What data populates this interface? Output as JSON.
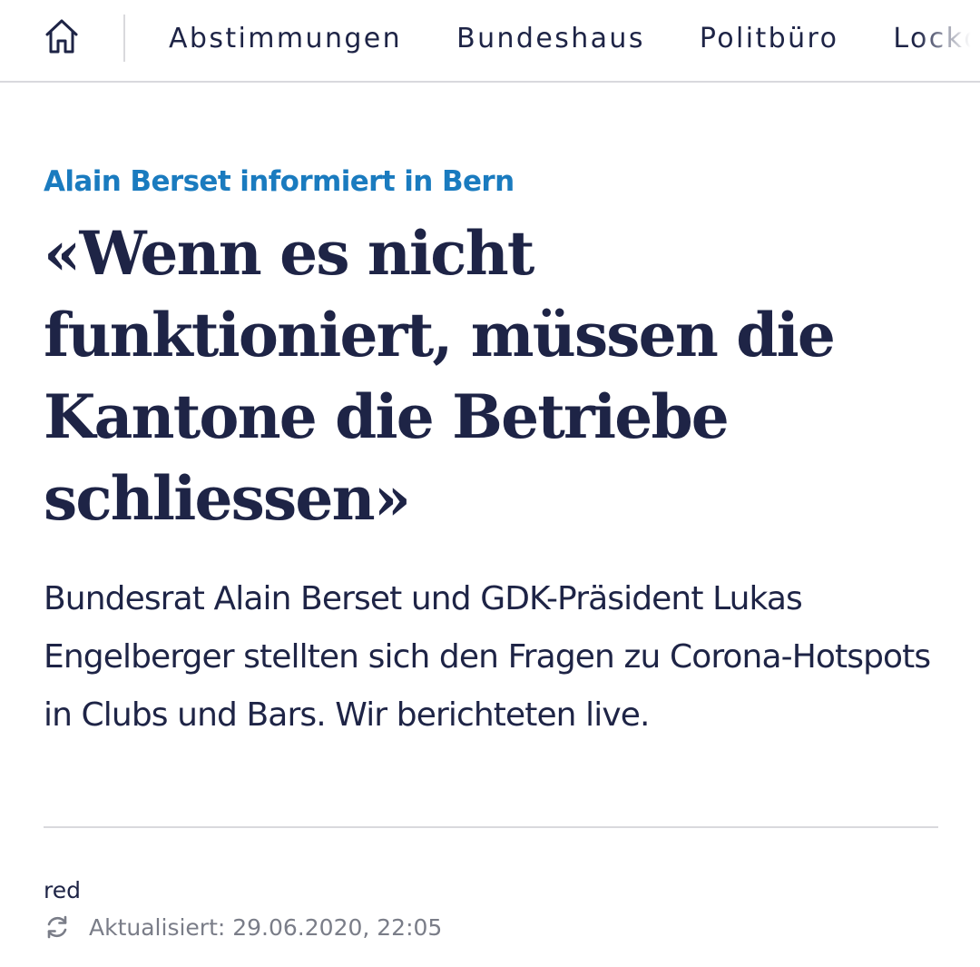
{
  "nav": {
    "home_icon": "home-icon",
    "items": [
      {
        "label": "Abstimmungen"
      },
      {
        "label": "Bundeshaus"
      },
      {
        "label": "Politbüro"
      },
      {
        "label": "Lockd"
      }
    ]
  },
  "article": {
    "kicker": "Alain Berset informiert in Bern",
    "headline": "«Wenn es nicht funktioniert, müssen die Kantone die Betriebe schliessen»",
    "lead": "Bundesrat Alain Berset und GDK-Präsident Lukas Engelberger stellten sich den Fragen zu Corona-Hotspots in Clubs und Bars. Wir berichteten live.",
    "author": "red",
    "updated_icon": "refresh-icon",
    "updated": "Aktualisiert: 29.06.2020, 22:05"
  },
  "colors": {
    "text": "#1e2446",
    "kicker": "#1a7bbf",
    "muted": "#7a7d88",
    "divider": "#d9d9dd"
  }
}
